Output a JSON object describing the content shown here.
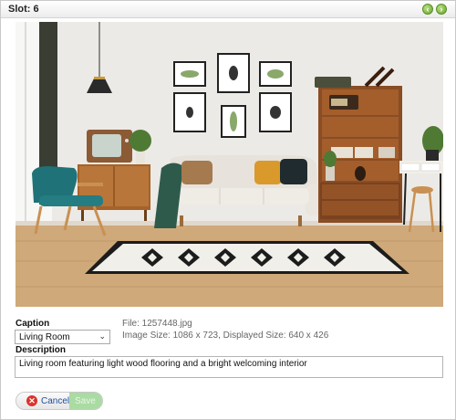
{
  "dialog": {
    "title": "Slot: 6",
    "nav_prev_icon": "circle-arrow-left-icon",
    "nav_next_icon": "circle-arrow-right-icon"
  },
  "photo": {
    "subject": "living-room-photo"
  },
  "caption": {
    "label": "Caption",
    "selected": "Living Room"
  },
  "file_info": {
    "file": "File: 1257448.jpg",
    "size": "Image Size: 1086 x 723, Displayed Size: 640 x 426"
  },
  "description": {
    "label": "Description",
    "value": "Living room featuring light wood flooring and a bright welcoming interior"
  },
  "buttons": {
    "cancel_label": "Cancel",
    "cancel_icon": "close-circle-icon",
    "save_label": "Save"
  },
  "colors": {
    "accent_green": "#6aa52e",
    "cancel_red": "#d9342b",
    "save_disabled": "#a9dba2",
    "link_blue": "#1e4f9c"
  }
}
